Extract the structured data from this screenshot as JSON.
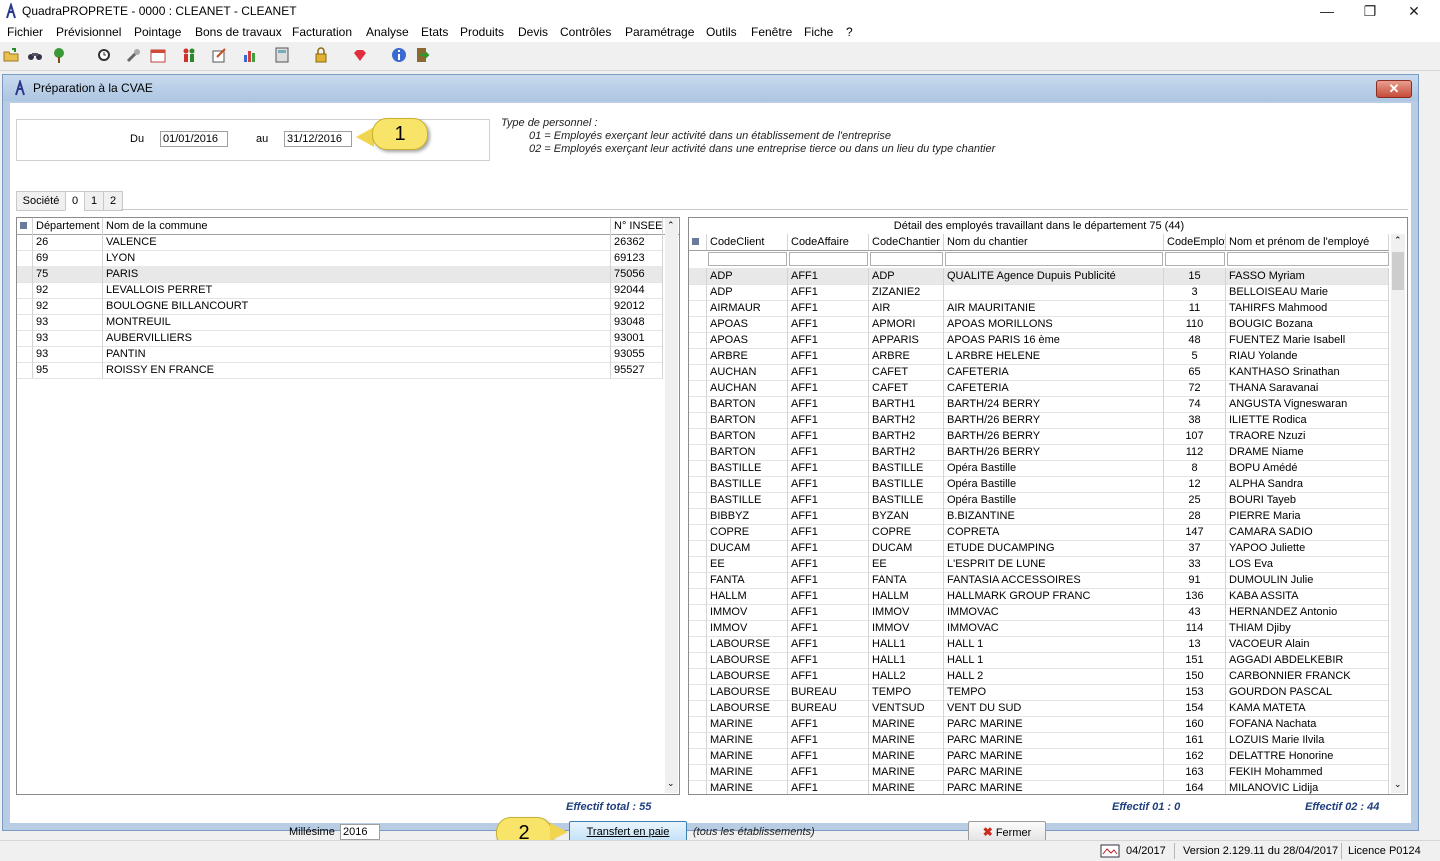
{
  "app": {
    "title": "QuadraPROPRETE - 0000 : CLEANET - CLEANET",
    "menu": [
      "Fichier",
      "Prévisionnel",
      "Pointage",
      "Bons de travaux",
      "Facturation",
      "Analyse",
      "Etats",
      "Produits",
      "Devis",
      "Contrôles",
      "Paramétrage",
      "Outils",
      "Fenêtre",
      "Fiche",
      "?"
    ]
  },
  "dialog": {
    "title": "Préparation à la CVAE",
    "close_label": "✕",
    "period": {
      "from_label": "Du",
      "from_value": "01/01/2016",
      "to_label": "au",
      "to_value": "31/12/2016"
    },
    "callout1": "1",
    "callout2": "2",
    "personnel_legend": {
      "title": "Type de personnel :",
      "line1": "01 = Employés exerçant leur activité dans un établissement de l'entreprise",
      "line2": "02 = Employés exerçant leur activité dans une entreprise tierce ou dans un lieu du type chantier"
    },
    "tabs": [
      "Société",
      "0",
      "1",
      "2"
    ],
    "left_grid": {
      "headers": [
        "Département",
        "Nom de la commune",
        "N° INSEE"
      ],
      "rows": [
        [
          "26",
          "VALENCE",
          "26362"
        ],
        [
          "69",
          "LYON",
          "69123"
        ],
        [
          "75",
          "PARIS",
          "75056"
        ],
        [
          "92",
          "LEVALLOIS PERRET",
          "92044"
        ],
        [
          "92",
          "BOULOGNE BILLANCOURT",
          "92012"
        ],
        [
          "93",
          "MONTREUIL",
          "93048"
        ],
        [
          "93",
          "AUBERVILLIERS",
          "93001"
        ],
        [
          "93",
          "PANTIN",
          "93055"
        ],
        [
          "95",
          "ROISSY EN FRANCE",
          "95527"
        ]
      ]
    },
    "right_grid": {
      "caption": "Détail des employés travaillant dans le département 75 (44)",
      "headers": [
        "CodeClient",
        "CodeAffaire",
        "CodeChantier",
        "Nom du chantier",
        "CodeEmploy",
        "Nom et prénom de l'employé"
      ],
      "rows": [
        [
          "ADP",
          "AFF1",
          "ADP",
          "QUALITE Agence Dupuis Publicité",
          "15",
          "FASSO Myriam"
        ],
        [
          "ADP",
          "AFF1",
          "ZIZANIE2",
          "",
          "3",
          "BELLOISEAU Marie"
        ],
        [
          "AIRMAUR",
          "AFF1",
          "AIR",
          "AIR MAURITANIE",
          "11",
          "TAHIRFS Mahmood"
        ],
        [
          "APOAS",
          "AFF1",
          "APMORI",
          "APOAS MORILLONS",
          "110",
          "BOUGIC Bozana"
        ],
        [
          "APOAS",
          "AFF1",
          "APPARIS",
          "APOAS PARIS 16 ème",
          "48",
          "FUENTEZ Marie Isabell"
        ],
        [
          "ARBRE",
          "AFF1",
          "ARBRE",
          "L ARBRE HELENE",
          "5",
          "RIAU Yolande"
        ],
        [
          "AUCHAN",
          "AFF1",
          "CAFET",
          "CAFETERIA",
          "65",
          "KANTHASO Srinathan"
        ],
        [
          "AUCHAN",
          "AFF1",
          "CAFET",
          "CAFETERIA",
          "72",
          "THANA Saravanai"
        ],
        [
          "BARTON",
          "AFF1",
          "BARTH1",
          "BARTH/24 BERRY",
          "74",
          "ANGUSTA Vigneswaran"
        ],
        [
          "BARTON",
          "AFF1",
          "BARTH2",
          "BARTH/26 BERRY",
          "38",
          "ILIETTE Rodica"
        ],
        [
          "BARTON",
          "AFF1",
          "BARTH2",
          "BARTH/26 BERRY",
          "107",
          "TRAORE Nzuzi"
        ],
        [
          "BARTON",
          "AFF1",
          "BARTH2",
          "BARTH/26 BERRY",
          "112",
          "DRAME Niame"
        ],
        [
          "BASTILLE",
          "AFF1",
          "BASTILLE",
          "Opéra Bastille",
          "8",
          "BOPU Amédé"
        ],
        [
          "BASTILLE",
          "AFF1",
          "BASTILLE",
          "Opéra Bastille",
          "12",
          "ALPHA Sandra"
        ],
        [
          "BASTILLE",
          "AFF1",
          "BASTILLE",
          "Opéra Bastille",
          "25",
          "BOURI Tayeb"
        ],
        [
          "BIBBYZ",
          "AFF1",
          "BYZAN",
          "B.BIZANTINE",
          "28",
          "PIERRE Maria"
        ],
        [
          "COPRE",
          "AFF1",
          "COPRE",
          "COPRETA",
          "147",
          "CAMARA SADIO"
        ],
        [
          "DUCAM",
          "AFF1",
          "DUCAM",
          "ETUDE DUCAMPING",
          "37",
          "YAPOO Juliette"
        ],
        [
          "EE",
          "AFF1",
          "EE",
          "L'ESPRIT DE LUNE",
          "33",
          "LOS Eva"
        ],
        [
          "FANTA",
          "AFF1",
          "FANTA",
          "FANTASIA  ACCESSOIRES",
          "91",
          "DUMOULIN Julie"
        ],
        [
          "HALLM",
          "AFF1",
          "HALLM",
          "HALLMARK GROUP FRANC",
          "136",
          "KABA ASSITA"
        ],
        [
          "IMMOV",
          "AFF1",
          "IMMOV",
          "IMMOVAC",
          "43",
          "HERNANDEZ Antonio"
        ],
        [
          "IMMOV",
          "AFF1",
          "IMMOV",
          "IMMOVAC",
          "114",
          "THIAM Djiby"
        ],
        [
          "LABOURSE",
          "AFF1",
          "HALL1",
          "HALL 1",
          "13",
          "VACOEUR Alain"
        ],
        [
          "LABOURSE",
          "AFF1",
          "HALL1",
          "HALL 1",
          "151",
          "AGGADI ABDELKEBIR"
        ],
        [
          "LABOURSE",
          "AFF1",
          "HALL2",
          "HALL 2",
          "150",
          "CARBONNIER FRANCK"
        ],
        [
          "LABOURSE",
          "BUREAU",
          "TEMPO",
          "TEMPO",
          "153",
          "GOURDON PASCAL"
        ],
        [
          "LABOURSE",
          "BUREAU",
          "VENTSUD",
          "VENT DU SUD",
          "154",
          "KAMA MATETA"
        ],
        [
          "MARINE",
          "AFF1",
          "MARINE",
          "PARC MARINE",
          "160",
          "FOFANA Nachata"
        ],
        [
          "MARINE",
          "AFF1",
          "MARINE",
          "PARC MARINE",
          "161",
          "LOZUIS Marie Ilvila"
        ],
        [
          "MARINE",
          "AFF1",
          "MARINE",
          "PARC MARINE",
          "162",
          "DELATTRE Honorine"
        ],
        [
          "MARINE",
          "AFF1",
          "MARINE",
          "PARC MARINE",
          "163",
          "FEKIH Mohammed"
        ],
        [
          "MARINE",
          "AFF1",
          "MARINE",
          "PARC MARINE",
          "164",
          "MILANOVIC Lidija"
        ]
      ]
    },
    "effectif_total": "Effectif total : 55",
    "effectif_01": "Effectif 01 : 0",
    "effectif_02": "Effectif 02 : 44",
    "millesime_label": "Millésime",
    "millesime_value": "2016",
    "transfer_button": "Transfert en paie",
    "transfer_note": "(tous les établissements)",
    "close_button": "Fermer"
  },
  "statusbar": {
    "period": "04/2017",
    "version": "Version 2.129.11 du 28/04/2017",
    "licence": "Licence P0124"
  },
  "colors": {
    "dialog_bg": "#b8cde4",
    "callout": "#f9e46a",
    "summary_text": "#1f3f7f",
    "close_x": "#cc2a1a"
  }
}
